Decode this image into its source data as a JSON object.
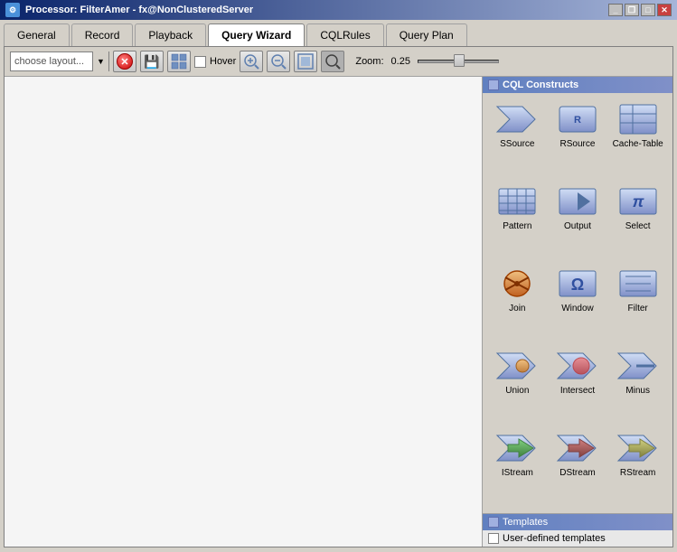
{
  "window": {
    "title": "Processor: FilterAmer - fx@NonClusteredServer",
    "icon": "processor-icon"
  },
  "title_bar_buttons": [
    "minimize",
    "maximize",
    "restore",
    "close"
  ],
  "tabs": [
    {
      "label": "General",
      "active": false
    },
    {
      "label": "Record",
      "active": false
    },
    {
      "label": "Playback",
      "active": false
    },
    {
      "label": "Query Wizard",
      "active": true
    },
    {
      "label": "CQLRules",
      "active": false
    },
    {
      "label": "Query Plan",
      "active": false
    }
  ],
  "toolbar": {
    "layout_placeholder": "choose layout...",
    "hover_label": "Hover",
    "zoom_label": "Zoom:",
    "zoom_value": "0.25",
    "buttons": [
      {
        "name": "delete-button",
        "icon": "✕",
        "tooltip": "Delete"
      },
      {
        "name": "save-button",
        "icon": "💾",
        "tooltip": "Save"
      },
      {
        "name": "grid-button",
        "icon": "⊞",
        "tooltip": "Grid"
      },
      {
        "name": "zoom-in-button",
        "icon": "🔍+",
        "tooltip": "Zoom In"
      },
      {
        "name": "zoom-out-button",
        "icon": "🔍-",
        "tooltip": "Zoom Out"
      },
      {
        "name": "fit-button",
        "icon": "⊡",
        "tooltip": "Fit"
      },
      {
        "name": "search-button",
        "icon": "🔍",
        "tooltip": "Search"
      }
    ]
  },
  "cql_constructs": {
    "header": "CQL Constructs",
    "items": [
      {
        "name": "SSource",
        "type": "ssource"
      },
      {
        "name": "RSource",
        "type": "rsource"
      },
      {
        "name": "Cache-Table",
        "type": "cache-table"
      },
      {
        "name": "Pattern",
        "type": "pattern"
      },
      {
        "name": "Output",
        "type": "output"
      },
      {
        "name": "Select",
        "type": "select"
      },
      {
        "name": "Join",
        "type": "join"
      },
      {
        "name": "Window",
        "type": "window"
      },
      {
        "name": "Filter",
        "type": "filter"
      },
      {
        "name": "Union",
        "type": "union"
      },
      {
        "name": "Intersect",
        "type": "intersect"
      },
      {
        "name": "Minus",
        "type": "minus"
      },
      {
        "name": "IStream",
        "type": "istream"
      },
      {
        "name": "DStream",
        "type": "dstream"
      },
      {
        "name": "RStream",
        "type": "rstream"
      }
    ]
  },
  "bottom_panel": {
    "templates_label": "Templates",
    "user_templates_label": "User-defined templates"
  }
}
